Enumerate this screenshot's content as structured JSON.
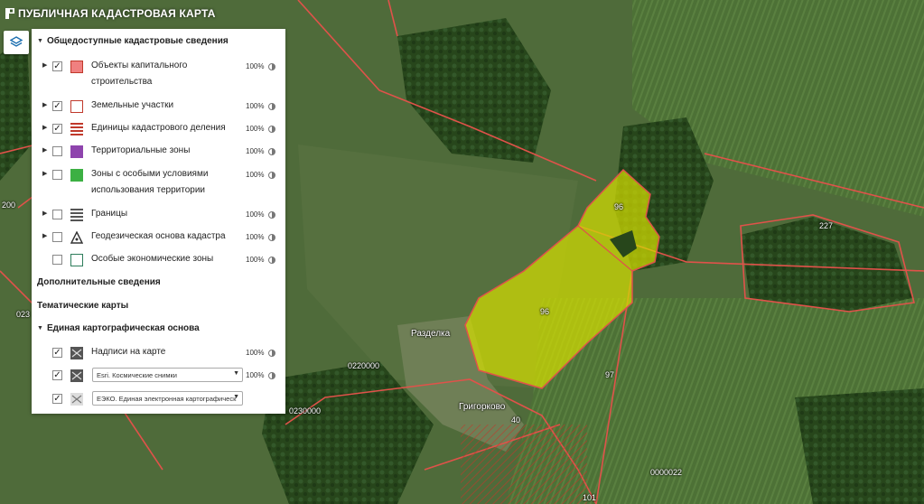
{
  "app": {
    "title": "ПУБЛИЧНАЯ КАДАСТРОВАЯ КАРТА"
  },
  "panel": {
    "section_public": "Общедоступные кадастровые сведения",
    "layers": [
      {
        "label": "Объекты капитального строительства",
        "checked": true,
        "opacity": "100%",
        "expandable": true,
        "icon": "oks-swatch-icon",
        "color": "#f08080"
      },
      {
        "label": "Земельные участки",
        "checked": true,
        "opacity": "100%",
        "expandable": true,
        "icon": "parcel-swatch-icon",
        "color": "#c0392b"
      },
      {
        "label": "Единицы кадастрового деления",
        "checked": true,
        "opacity": "100%",
        "expandable": true,
        "icon": "cadastral-division-icon",
        "color": "#c0392b"
      },
      {
        "label": "Территориальные зоны",
        "checked": false,
        "opacity": "100%",
        "expandable": true,
        "icon": "territorial-zone-icon",
        "color": "#8e44ad"
      },
      {
        "label": "Зоны с особыми условиями использования территории",
        "checked": false,
        "opacity": "100%",
        "expandable": true,
        "icon": "special-zone-icon",
        "color": "#3cb043"
      },
      {
        "label": "Границы",
        "checked": false,
        "opacity": "100%",
        "expandable": true,
        "icon": "borders-icon",
        "color": "#555555"
      },
      {
        "label": "Геодезическая основа кадастра",
        "checked": false,
        "opacity": "100%",
        "expandable": true,
        "icon": "geodesic-icon",
        "color": "#333333"
      },
      {
        "label": "Особые экономические зоны",
        "checked": false,
        "opacity": "100%",
        "expandable": false,
        "icon": "economic-zone-icon",
        "color": "#2e7d5b"
      }
    ],
    "section_additional": "Дополнительные сведения",
    "section_thematic": "Тематические карты",
    "section_base": "Единая картографическая основа",
    "base_layers": [
      {
        "label": "Надписи на карте",
        "checked": true,
        "opacity": "100%"
      },
      {
        "select": "Esri. Космические снимки",
        "checked": true,
        "opacity": "100%"
      },
      {
        "select": "ЕЭКО. Единая электронная картографическ",
        "checked": true
      }
    ]
  },
  "map_labels": {
    "plot_a": "96",
    "plot_b": "96",
    "plot_c": "97",
    "plot_d": "227",
    "village_1": "Разделка",
    "village_2": "Григорково",
    "q1": "0220000",
    "q2": "0230000",
    "q3": "0000022",
    "r1": "200",
    "r2": "023",
    "r3": "101",
    "r4": "40"
  },
  "colors": {
    "highlight_fill": "#d6e000",
    "boundary": "#e0524a",
    "panel_bg": "#ffffff"
  }
}
